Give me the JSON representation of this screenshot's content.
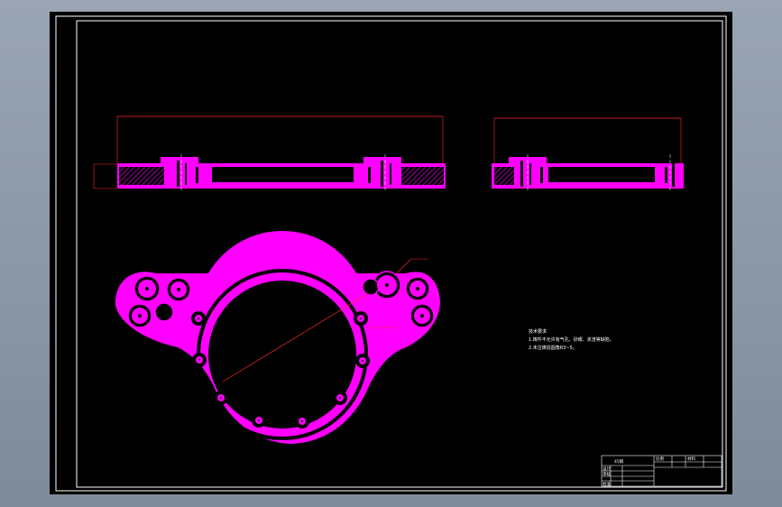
{
  "drawing": {
    "background": "#000000",
    "border_color": "#ffffff",
    "part_color": "#ff00ff",
    "dimension_color": "#ff2a2a",
    "frame_color": "#9aa5b3"
  },
  "dimensions": {
    "front_length": "",
    "front_height": "",
    "side_length": "",
    "callout_upper": "",
    "callout_lower": ""
  },
  "notes": {
    "heading": "技术要求",
    "line1": "1.铸件不允许有气孔、砂眼、夹渣等缺陷。",
    "line2": "2.未注铸造圆角R3~5。"
  },
  "title_block": {
    "part_name": "45钢",
    "scale_label": "比例",
    "material_label": "材料",
    "designed": "设计",
    "checked": "审核",
    "approved": "批准"
  }
}
